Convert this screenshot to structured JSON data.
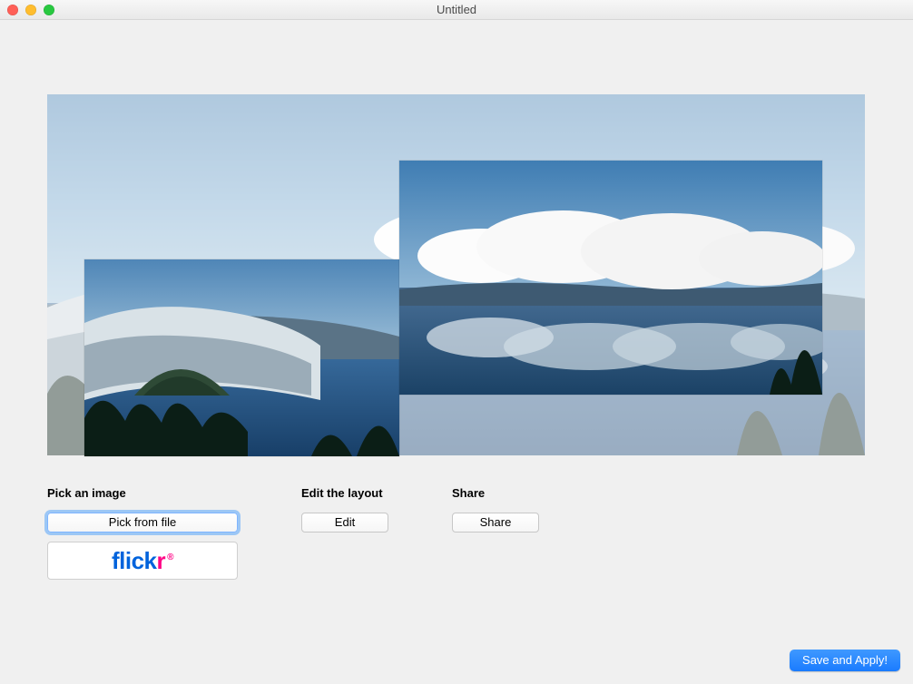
{
  "window": {
    "title": "Untitled"
  },
  "sections": {
    "pick": {
      "heading": "Pick an image",
      "pick_from_file": "Pick from file",
      "flickr_aria": "Pick from flickr"
    },
    "edit": {
      "heading": "Edit the layout",
      "button": "Edit"
    },
    "share": {
      "heading": "Share",
      "button": "Share"
    }
  },
  "primary_action": "Save and Apply!",
  "flickr_logo": {
    "blue": "flick",
    "pink": "r",
    "reg": "®"
  }
}
